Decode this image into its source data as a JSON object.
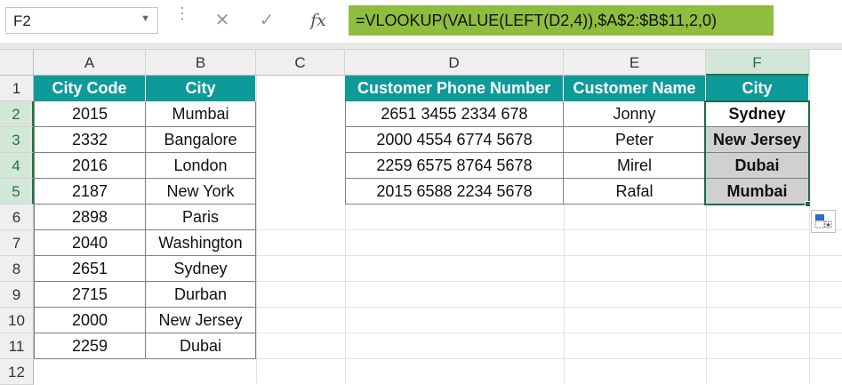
{
  "name_box": {
    "value": "F2"
  },
  "formula_bar": {
    "cancel": "✕",
    "enter": "✓",
    "fx": "fx",
    "formula": "=VLOOKUP(VALUE(LEFT(D2,4)),$A$2:$B$11,2,0)"
  },
  "columns": [
    "A",
    "B",
    "C",
    "D",
    "E",
    "F"
  ],
  "rows": [
    "1",
    "2",
    "3",
    "4",
    "5",
    "6",
    "7",
    "8",
    "9",
    "10",
    "11",
    "12"
  ],
  "table1": {
    "headers": [
      "City Code",
      "City"
    ],
    "rows": [
      [
        "2015",
        "Mumbai"
      ],
      [
        "2332",
        "Bangalore"
      ],
      [
        "2016",
        "London"
      ],
      [
        "2187",
        "New York"
      ],
      [
        "2898",
        "Paris"
      ],
      [
        "2040",
        "Washington"
      ],
      [
        "2651",
        "Sydney"
      ],
      [
        "2715",
        "Durban"
      ],
      [
        "2000",
        "New Jersey"
      ],
      [
        "2259",
        "Dubai"
      ]
    ]
  },
  "table2": {
    "headers": [
      "Customer Phone Number",
      "Customer Name",
      "City"
    ],
    "rows": [
      [
        "2651 3455 2334 678",
        "Jonny",
        "Sydney"
      ],
      [
        "2000 4554 6774 5678",
        "Peter",
        "New Jersey"
      ],
      [
        "2259 6575 8764 5678",
        "Mirel",
        "Dubai"
      ],
      [
        "2015 6588 2234 5678",
        "Rafal",
        "Mumbai"
      ]
    ]
  },
  "colors": {
    "header": "#0f9a9a",
    "formula_highlight": "#8fbd3e",
    "selection": "#1d6b45"
  }
}
